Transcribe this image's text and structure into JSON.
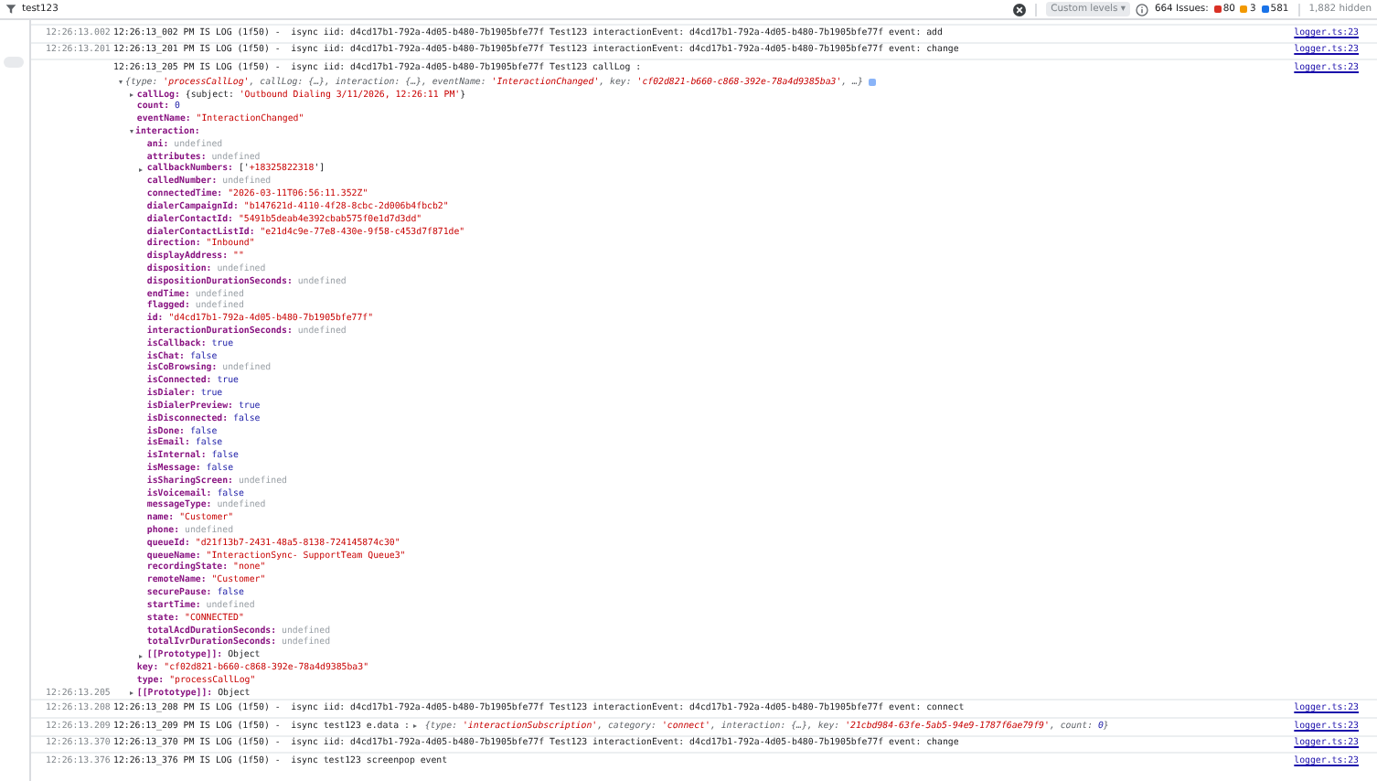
{
  "toolbar": {
    "filter_value": "test123",
    "levels": "Custom levels ▾",
    "issues_label": "664 Issues:",
    "issue_counts": [
      {
        "count": "80",
        "color": "#d93025"
      },
      {
        "count": "3",
        "color": "#f29900"
      },
      {
        "count": "581",
        "color": "#1a73e8"
      }
    ],
    "hidden": "1,882 hidden"
  },
  "messages": [
    {
      "timestamp": "12:26:13.002",
      "text": "12:26:13_002 PM IS LOG (1f50) -  isync iid: d4cd17b1-792a-4d05-b480-7b1905bfe77f Test123 interactionEvent: d4cd17b1-792a-4d05-b480-7b1905bfe77f event: add",
      "source": "logger.ts:23"
    },
    {
      "timestamp": "12:26:13.201",
      "text": "12:26:13_201 PM IS LOG (1f50) -  isync iid: d4cd17b1-792a-4d05-b480-7b1905bfe77f Test123 interactionEvent: d4cd17b1-792a-4d05-b480-7b1905bfe77f event: change",
      "source": "logger.ts:23"
    },
    {
      "text": "12:26:13_205 PM IS LOG (1f50) -  isync iid: d4cd17b1-792a-4d05-b480-7b1905bfe77f Test123 callLog :",
      "source": "logger.ts:23",
      "object": {
        "expanded": true,
        "summary": [
          {
            "text": "{type: ",
            "kind": "plain"
          },
          {
            "text": "'processCallLog'",
            "kind": "string"
          },
          {
            "text": ", callLog: {…}, interaction: {…}, eventName: ",
            "kind": "plain"
          },
          {
            "text": "'InteractionChanged'",
            "kind": "string"
          },
          {
            "text": ", key: ",
            "kind": "plain"
          },
          {
            "text": "'cf02d821-b660-c868-392e-78a4d9385ba3'",
            "kind": "string"
          },
          {
            "text": ", …}",
            "kind": "plain"
          }
        ],
        "children": [
          {
            "expanded": false,
            "label": "callLog:",
            "value_parts": [
              {
                "text": "{subject: ",
                "kind": "plain"
              },
              {
                "text": "'Outbound Dialing 3/11/2026, 12:26:11 PM'",
                "kind": "string"
              },
              {
                "text": "}",
                "kind": "plain"
              }
            ]
          },
          {
            "label": "count:",
            "value": "0",
            "kind": "number"
          },
          {
            "label": "eventName:",
            "value": "\"InteractionChanged\"",
            "kind": "string"
          },
          {
            "expanded": true,
            "label": "interaction:",
            "children": [
              {
                "label": "ani:",
                "value": "undefined",
                "kind": "undefined"
              },
              {
                "label": "attributes:",
                "value": "undefined",
                "kind": "undefined"
              },
              {
                "expanded": false,
                "label": "callbackNumbers:",
                "value_parts": [
                  {
                    "text": "['",
                    "kind": "plain"
                  },
                  {
                    "text": "+18325822318",
                    "kind": "string"
                  },
                  {
                    "text": "']",
                    "kind": "plain"
                  }
                ]
              },
              {
                "label": "calledNumber:",
                "value": "undefined",
                "kind": "undefined"
              },
              {
                "label": "connectedTime:",
                "value": "\"2026-03-11T06:56:11.352Z\"",
                "kind": "string"
              },
              {
                "label": "dialerCampaignId:",
                "value": "\"b147621d-4110-4f28-8cbc-2d006b4fbcb2\"",
                "kind": "string"
              },
              {
                "label": "dialerContactId:",
                "value": "\"5491b5deab4e392cbab575f0e1d7d3dd\"",
                "kind": "string"
              },
              {
                "label": "dialerContactListId:",
                "value": "\"e21d4c9e-77e8-430e-9f58-c453d7f871de\"",
                "kind": "string"
              },
              {
                "label": "direction:",
                "value": "\"Inbound\"",
                "kind": "string"
              },
              {
                "label": "displayAddress:",
                "value": "\"\"",
                "kind": "string"
              },
              {
                "label": "disposition:",
                "value": "undefined",
                "kind": "undefined"
              },
              {
                "label": "dispositionDurationSeconds:",
                "value": "undefined",
                "kind": "undefined"
              },
              {
                "label": "endTime:",
                "value": "undefined",
                "kind": "undefined"
              },
              {
                "label": "flagged:",
                "value": "undefined",
                "kind": "undefined"
              },
              {
                "label": "id:",
                "value": "\"d4cd17b1-792a-4d05-b480-7b1905bfe77f\"",
                "kind": "string"
              },
              {
                "label": "interactionDurationSeconds:",
                "value": "undefined",
                "kind": "undefined"
              },
              {
                "label": "isCallback:",
                "value": "true",
                "kind": "boolean"
              },
              {
                "label": "isChat:",
                "value": "false",
                "kind": "boolean"
              },
              {
                "label": "isCoBrowsing:",
                "value": "undefined",
                "kind": "undefined"
              },
              {
                "label": "isConnected:",
                "value": "true",
                "kind": "boolean"
              },
              {
                "label": "isDialer:",
                "value": "true",
                "kind": "boolean"
              },
              {
                "label": "isDialerPreview:",
                "value": "true",
                "kind": "boolean"
              },
              {
                "label": "isDisconnected:",
                "value": "false",
                "kind": "boolean"
              },
              {
                "label": "isDone:",
                "value": "false",
                "kind": "boolean"
              },
              {
                "label": "isEmail:",
                "value": "false",
                "kind": "boolean"
              },
              {
                "label": "isInternal:",
                "value": "false",
                "kind": "boolean"
              },
              {
                "label": "isMessage:",
                "value": "false",
                "kind": "boolean"
              },
              {
                "label": "isSharingScreen:",
                "value": "undefined",
                "kind": "undefined"
              },
              {
                "label": "isVoicemail:",
                "value": "false",
                "kind": "boolean"
              },
              {
                "label": "messageType:",
                "value": "undefined",
                "kind": "undefined"
              },
              {
                "label": "name:",
                "value": "\"Customer\"",
                "kind": "string"
              },
              {
                "label": "phone:",
                "value": "undefined",
                "kind": "undefined"
              },
              {
                "label": "queueId:",
                "value": "\"d21f13b7-2431-48a5-8138-724145874c30\"",
                "kind": "string"
              },
              {
                "label": "queueName:",
                "value": "\"InteractionSync- SupportTeam Queue3\"",
                "kind": "string"
              },
              {
                "label": "recordingState:",
                "value": "\"none\"",
                "kind": "string"
              },
              {
                "label": "remoteName:",
                "value": "\"Customer\"",
                "kind": "string"
              },
              {
                "label": "securePause:",
                "value": "false",
                "kind": "boolean"
              },
              {
                "label": "startTime:",
                "value": "undefined",
                "kind": "undefined"
              },
              {
                "label": "state:",
                "value": "\"CONNECTED\"",
                "kind": "string"
              },
              {
                "label": "totalAcdDurationSeconds:",
                "value": "undefined",
                "kind": "undefined"
              },
              {
                "label": "totalIvrDurationSeconds:",
                "value": "undefined",
                "kind": "undefined"
              },
              {
                "expanded": false,
                "label": "[[Prototype]]:",
                "value": "Object",
                "kind": "object"
              }
            ]
          },
          {
            "label": "key:",
            "value": "\"cf02d821-b660-c868-392e-78a4d9385ba3\"",
            "kind": "string"
          },
          {
            "label": "type:",
            "value": "\"processCallLog\"",
            "kind": "string"
          },
          {
            "expanded": false,
            "timestamp": "12:26:13.205",
            "label": "[[Prototype]]:",
            "value": "Object",
            "kind": "object"
          }
        ]
      }
    },
    {
      "timestamp": "12:26:13.208",
      "text": "12:26:13_208 PM IS LOG (1f50) -  isync iid: d4cd17b1-792a-4d05-b480-7b1905bfe77f Test123 interactionEvent: d4cd17b1-792a-4d05-b480-7b1905bfe77f event: connect",
      "source": "logger.ts:23"
    },
    {
      "timestamp": "12:26:13.209",
      "text": "12:26:13_209 PM IS LOG (1f50) -  isync test123 e.data :",
      "source": "logger.ts:23",
      "object": {
        "expanded": false,
        "summary": [
          {
            "text": "{type: ",
            "kind": "plain"
          },
          {
            "text": "'interactionSubscription'",
            "kind": "string"
          },
          {
            "text": ", category: ",
            "kind": "plain"
          },
          {
            "text": "'connect'",
            "kind": "string"
          },
          {
            "text": ", interaction: {…}, key: ",
            "kind": "plain"
          },
          {
            "text": "'21cbd984-63fe-5ab5-94e9-1787f6ae79f9'",
            "kind": "string"
          },
          {
            "text": ", count: ",
            "kind": "plain"
          },
          {
            "text": "0",
            "kind": "number"
          },
          {
            "text": "}",
            "kind": "plain"
          }
        ]
      }
    },
    {
      "timestamp": "12:26:13.370",
      "text": "12:26:13_370 PM IS LOG (1f50) -  isync iid: d4cd17b1-792a-4d05-b480-7b1905bfe77f Test123 interactionEvent: d4cd17b1-792a-4d05-b480-7b1905bfe77f event: change",
      "source": "logger.ts:23"
    },
    {
      "timestamp": "12:26:13.376",
      "text": "12:26:13_376 PM IS LOG (1f50) -  isync test123 screenpop event",
      "source": "logger.ts:23"
    }
  ]
}
